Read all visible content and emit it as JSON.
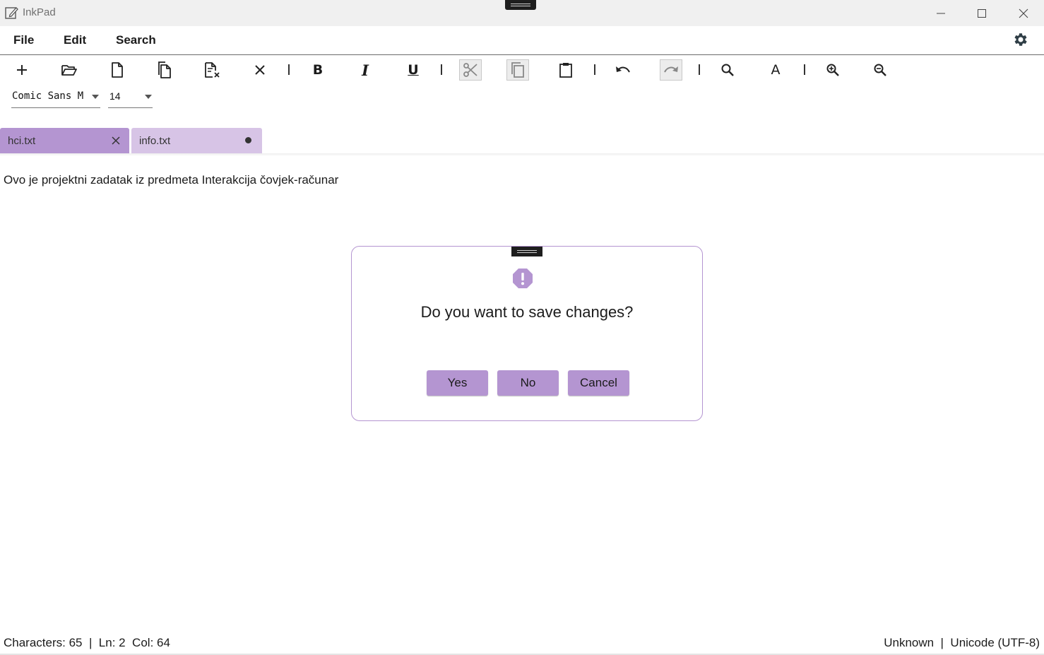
{
  "window": {
    "title": "InkPad",
    "controls": [
      "minimize-icon",
      "maximize-icon",
      "close-icon"
    ]
  },
  "menu": {
    "file": "File",
    "edit": "Edit",
    "search": "Search",
    "settings_icon": "gear-icon"
  },
  "toolbar": {
    "buttons": [
      "new-icon",
      "open-folder-icon",
      "new-file-icon",
      "copy-file-icon",
      "close-file-icon",
      "close-icon",
      "bold-icon",
      "italic-icon",
      "underline-icon",
      "cut-icon",
      "copy-icon",
      "paste-icon",
      "undo-icon",
      "redo-icon",
      "search-icon",
      "font-icon",
      "zoom-in-icon",
      "zoom-out-icon"
    ],
    "font_family": "Comic Sans M",
    "font_size": "14"
  },
  "tabs": [
    {
      "label": "hci.txt",
      "state": "close"
    },
    {
      "label": "info.txt",
      "state": "unsaved"
    }
  ],
  "editor": {
    "content": "Ovo je projektni zadatak iz predmeta Interakcija čovjek-računar"
  },
  "dialog": {
    "message": "Do you want to save changes?",
    "yes": "Yes",
    "no": "No",
    "cancel": "Cancel"
  },
  "status": {
    "left": "Characters: 65  |  Ln: 2  Col: 64",
    "right": "Unknown  |  Unicode (UTF-8)"
  },
  "colors": {
    "accent": "#b495d1",
    "tab_inactive": "#d7c4e6"
  }
}
